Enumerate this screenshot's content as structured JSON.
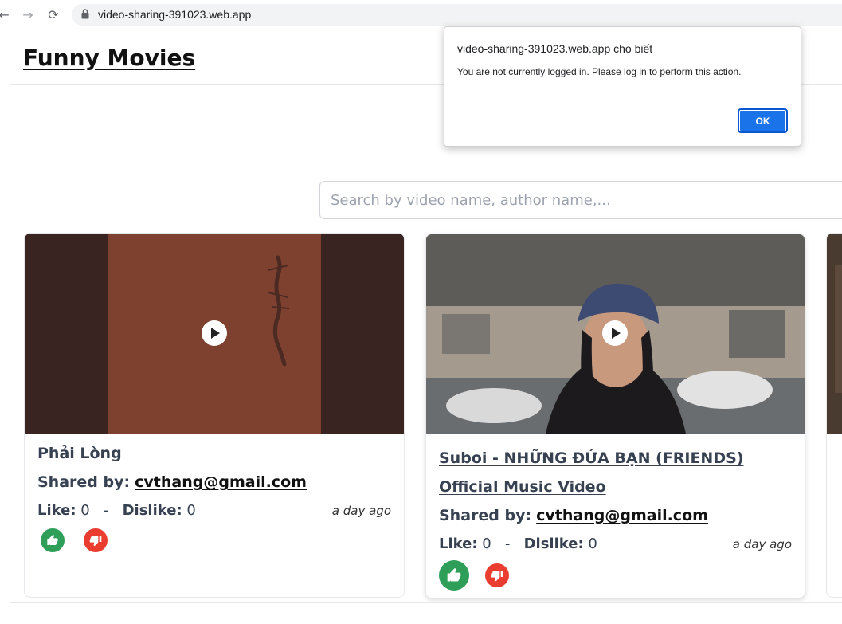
{
  "browser": {
    "url": "video-sharing-391023.web.app"
  },
  "header": {
    "title": "Funny Movies"
  },
  "search": {
    "placeholder": "Search by video name, author name,..."
  },
  "videos": [
    {
      "title": "Phải Lòng",
      "shared_label": "Shared by:",
      "shared_by": "cvthang@gmail.com",
      "like_label": "Like:",
      "like_count": "0",
      "separator": "-",
      "dislike_label": "Dislike:",
      "dislike_count": "0",
      "time_ago": "a day ago"
    },
    {
      "title": "Suboi - NHỮNG ĐỨA BẠN (FRIENDS) Official Music Video",
      "shared_label": "Shared by:",
      "shared_by": "cvthang@gmail.com",
      "like_label": "Like:",
      "like_count": "0",
      "separator": "-",
      "dislike_label": "Dislike:",
      "dislike_count": "0",
      "time_ago": "a day ago"
    }
  ],
  "dialog": {
    "title": "video-sharing-391023.web.app cho biết",
    "message": "You are not currently logged in. Please log in to perform this action.",
    "ok_label": "OK"
  },
  "colors": {
    "like": "#2e9e58",
    "dislike": "#ea3d2f",
    "dialog_button": "#1a73e8"
  }
}
